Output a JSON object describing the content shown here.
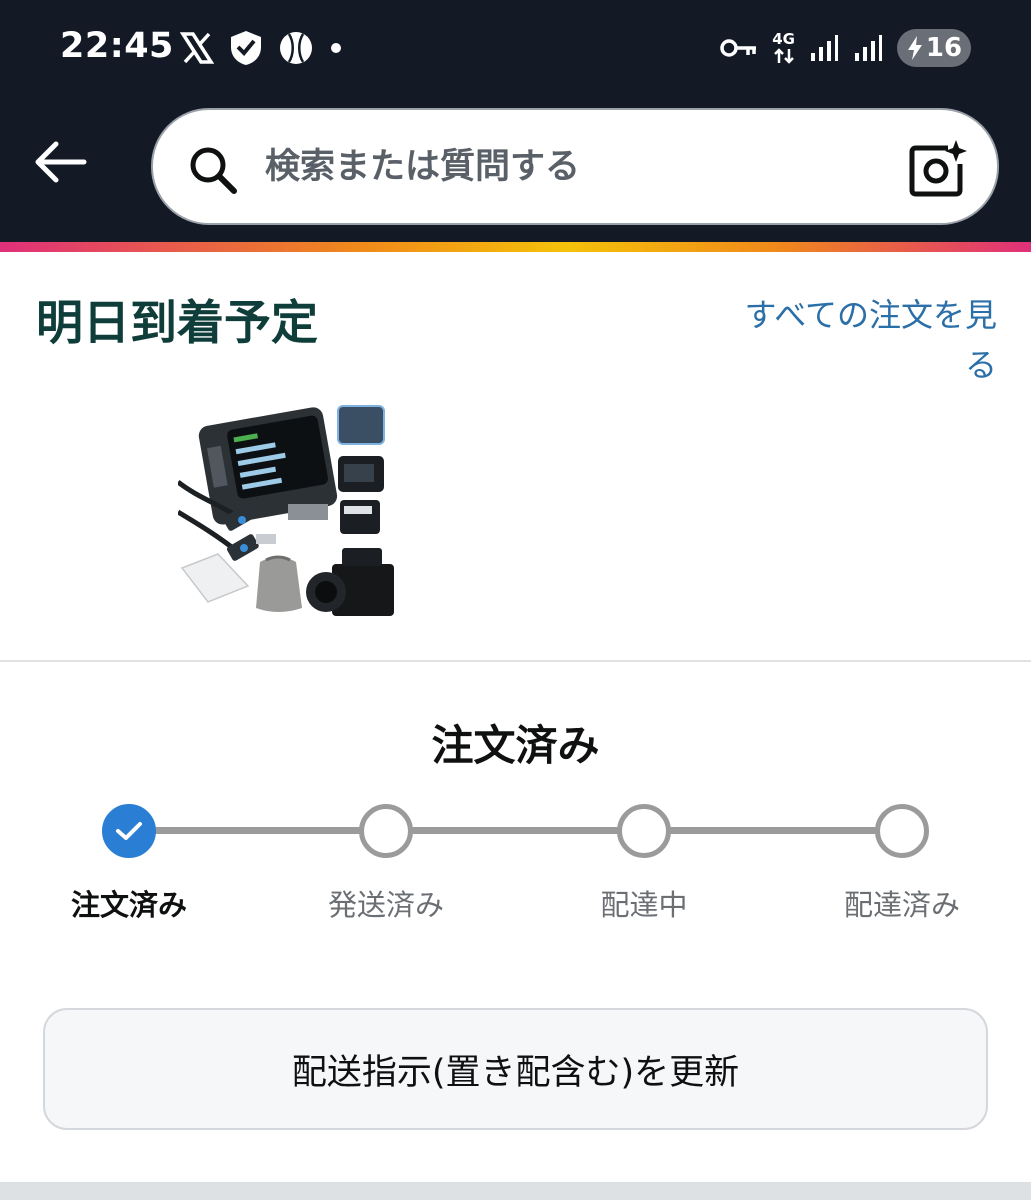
{
  "status_bar": {
    "time": "22:45",
    "left_icons": [
      "x-logo-icon",
      "shield-check-icon",
      "baseball-icon",
      "notification-dot-icon"
    ],
    "network_label_top": "4G",
    "battery_level": "16",
    "right_icons": [
      "vpn-key-icon",
      "network-4g-icon",
      "signal-bars-icon",
      "signal-bars-icon",
      "battery-charging-icon"
    ]
  },
  "header": {
    "back_icon": "back-arrow-icon",
    "search": {
      "placeholder": "検索または質問する",
      "value": "",
      "icon": "search-icon",
      "camera_icon": "camera-lens-icon"
    },
    "accent_colors": [
      "#e0307a",
      "#f08a1a",
      "#f5c20a"
    ]
  },
  "delivery": {
    "title": "明日到着予定",
    "all_orders_link": "すべての注文を見る",
    "product_image_alt": "Godox X3 flash trigger set"
  },
  "order_status": {
    "heading": "注文済み",
    "current_step": 0,
    "steps": [
      {
        "label": "注文済み",
        "done": true
      },
      {
        "label": "発送済み",
        "done": false
      },
      {
        "label": "配達中",
        "done": false
      },
      {
        "label": "配達済み",
        "done": false
      }
    ],
    "active_color": "#2a7fd4",
    "inactive_color": "#9b9b9b"
  },
  "actions": {
    "update_button_label": "配送指示(置き配含む)を更新"
  }
}
